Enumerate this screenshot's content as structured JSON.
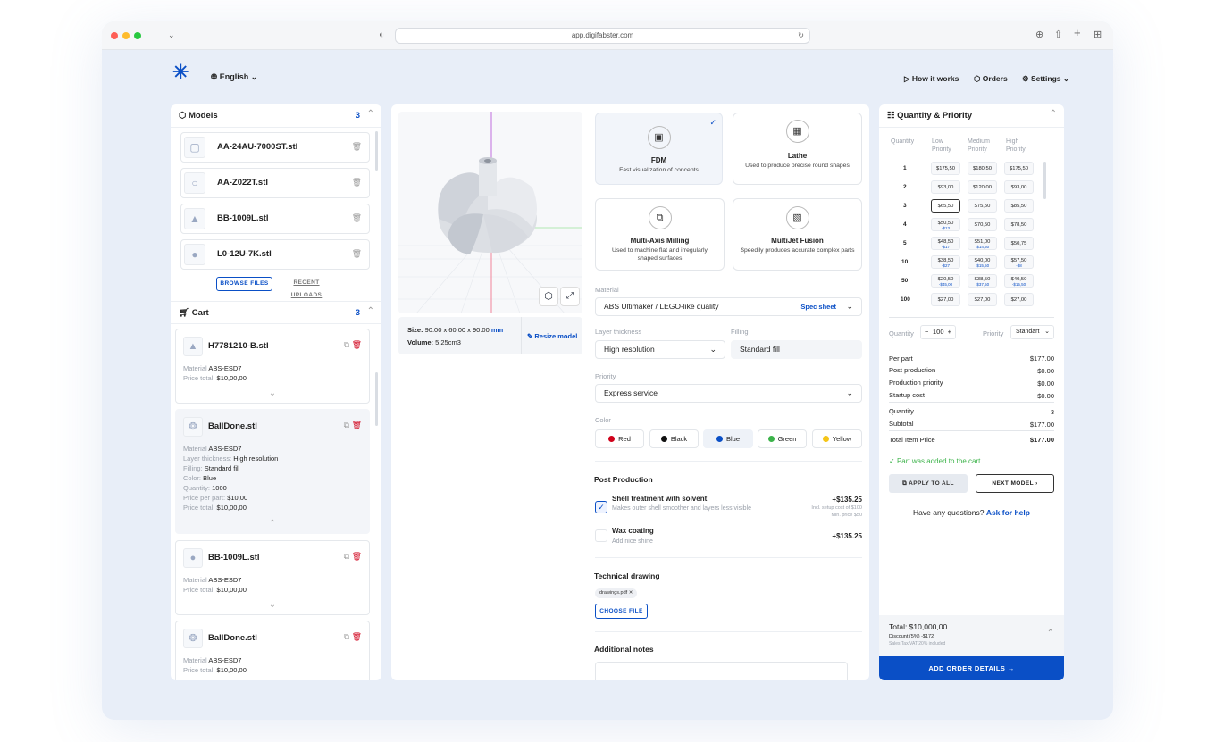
{
  "browser": {
    "url": "app.digifabster.com"
  },
  "header": {
    "logo": "✳",
    "language": "English",
    "how": "How it works",
    "orders": "Orders",
    "settings": "Settings"
  },
  "models": {
    "title": "Models",
    "count": "3",
    "items": [
      "AA-24AU-7000ST.stl",
      "AA-Z022T.stl",
      "BB-1009L.stl",
      "L0-12U-7K.stl"
    ],
    "browse": "BROWSE FILES",
    "recent": "RECENT UPLOADS"
  },
  "cart": {
    "title": "Cart",
    "count": "3",
    "items": [
      {
        "name": "H7781210-B.stl",
        "material_k": "Material",
        "material": "ABS-ESD7",
        "price_k": "Price total:",
        "price": "$10,00,00"
      },
      {
        "name": "BallDone.stl",
        "material_k": "Material",
        "material": "ABS-ESD7",
        "layer_k": "Layer thickness:",
        "layer": "High resolution",
        "fill_k": "Filling:",
        "fill": "Standard fill",
        "color_k": "Color:",
        "color": "Blue",
        "qty_k": "Quantity:",
        "qty": "1000",
        "ppp_k": "Price per part:",
        "ppp": "$10,00",
        "price_k": "Price total:",
        "price": "$10,00,00"
      },
      {
        "name": "BB-1009L.stl",
        "material_k": "Material",
        "material": "ABS-ESD7",
        "price_k": "Price total:",
        "price": "$10,00,00"
      },
      {
        "name": "BallDone.stl",
        "material_k": "Material",
        "material": "ABS-ESD7",
        "price_k": "Price total:",
        "price": "$10,00,00"
      }
    ]
  },
  "viewer": {
    "size_k": "Size:",
    "size": "90.00 x 60.00 x 90.00",
    "unit": "mm",
    "volume_k": "Volume:",
    "volume": "5.25cm3",
    "resize": "Resize model"
  },
  "tech": [
    {
      "name": "FDM",
      "desc": "Fast visualization of concepts"
    },
    {
      "name": "Lathe",
      "desc": "Used to produce precise round shapes"
    },
    {
      "name": "Multi-Axis Milling",
      "desc": "Used to machine flat and irregularly shaped surfaces"
    },
    {
      "name": "MultiJet Fusion",
      "desc": "Speedily produces accurate complex parts"
    }
  ],
  "config": {
    "material_label": "Material",
    "material": "ABS Ultimaker / LEGO-like quality",
    "spec": "Spec sheet",
    "layer_label": "Layer thickness",
    "layer": "High resolution",
    "filling_label": "Filling",
    "filling": "Standard fill",
    "priority_label": "Priority",
    "priority": "Express service",
    "color_label": "Color",
    "colors": [
      {
        "name": "Red",
        "hex": "#d0021b"
      },
      {
        "name": "Black",
        "hex": "#111111"
      },
      {
        "name": "Blue",
        "hex": "#0a4fc6"
      },
      {
        "name": "Green",
        "hex": "#3cb34a"
      },
      {
        "name": "Yellow",
        "hex": "#f5c518"
      }
    ]
  },
  "post": {
    "title": "Post Production",
    "items": [
      {
        "name": "Shell treatment with solvent",
        "desc": "Makes outer shell smoother and layers less visible",
        "price": "+$135.25",
        "note1": "Incl. setup cost of $100",
        "note2": "Min. price $50"
      },
      {
        "name": "Wax coating",
        "desc": "Add nice shine",
        "price": "+$135.25"
      }
    ]
  },
  "drawing": {
    "title": "Technical drawing",
    "file": "drawings.pdf",
    "choose": "CHOOSE FILE"
  },
  "notes": {
    "title": "Additional notes"
  },
  "qp": {
    "title": "Quantity & Priority",
    "h_qty": "Quantity",
    "h_low": "Low Priority",
    "h_med": "Medium Priority",
    "h_high": "High Priority",
    "rows": [
      {
        "q": "1",
        "c": [
          {
            "p": "$175,50",
            "s": ""
          },
          {
            "p": "$180,50",
            "s": ""
          },
          {
            "p": "$175,50",
            "s": ""
          }
        ]
      },
      {
        "q": "2",
        "c": [
          {
            "p": "$93,00",
            "s": ""
          },
          {
            "p": "$120,00",
            "s": ""
          },
          {
            "p": "$93,00",
            "s": ""
          }
        ]
      },
      {
        "q": "3",
        "c": [
          {
            "p": "$65,50",
            "s": ""
          },
          {
            "p": "$75,50",
            "s": ""
          },
          {
            "p": "$85,50",
            "s": ""
          }
        ]
      },
      {
        "q": "4",
        "c": [
          {
            "p": "$50,50",
            "s": "-$13"
          },
          {
            "p": "$70,50",
            "s": ""
          },
          {
            "p": "$78,50",
            "s": ""
          }
        ]
      },
      {
        "q": "5",
        "c": [
          {
            "p": "$48,50",
            "s": "-$17"
          },
          {
            "p": "$51,00",
            "s": "-$14,50"
          },
          {
            "p": "$50,75",
            "s": ""
          }
        ]
      },
      {
        "q": "10",
        "c": [
          {
            "p": "$38,50",
            "s": "-$27"
          },
          {
            "p": "$40,00",
            "s": "-$15,50"
          },
          {
            "p": "$57,50",
            "s": "-$8"
          }
        ]
      },
      {
        "q": "50",
        "c": [
          {
            "p": "$20,50",
            "s": "-$45,00"
          },
          {
            "p": "$38,50",
            "s": "-$37,50"
          },
          {
            "p": "$40,50",
            "s": "-$15,50"
          }
        ]
      },
      {
        "q": "100",
        "c": [
          {
            "p": "$27,00",
            "s": ""
          },
          {
            "p": "$27,00",
            "s": ""
          },
          {
            "p": "$27,00",
            "s": ""
          }
        ]
      }
    ],
    "qty_label": "Quantity",
    "qty": "100",
    "prio_label": "Priority",
    "prio": "Standart",
    "summary": [
      [
        "Per part",
        "$177.00"
      ],
      [
        "Post production",
        "$0.00"
      ],
      [
        "Production priority",
        "$0.00"
      ],
      [
        "Startup cost",
        "$0.00"
      ]
    ],
    "quantity_k": "Quantity",
    "quantity_v": "3",
    "subtotal_k": "Subtotal",
    "subtotal_v": "$177.00",
    "total_k": "Total Item Price",
    "total_v": "$177.00",
    "added": "Part was added to the cart",
    "apply": "APPLY TO ALL",
    "next": "NEXT MODEL",
    "question": "Have any questions?",
    "ask": "Ask for help",
    "grand": "Total: $10,000,00",
    "discount": "Discount (5%) -$172",
    "vat": "Sales Tax/VAT 20% included",
    "order": "ADD ORDER DETAILS →"
  },
  "colors": {
    "accent": "#0a4fc6",
    "success": "#3cb34a",
    "danger": "#d0021b"
  }
}
